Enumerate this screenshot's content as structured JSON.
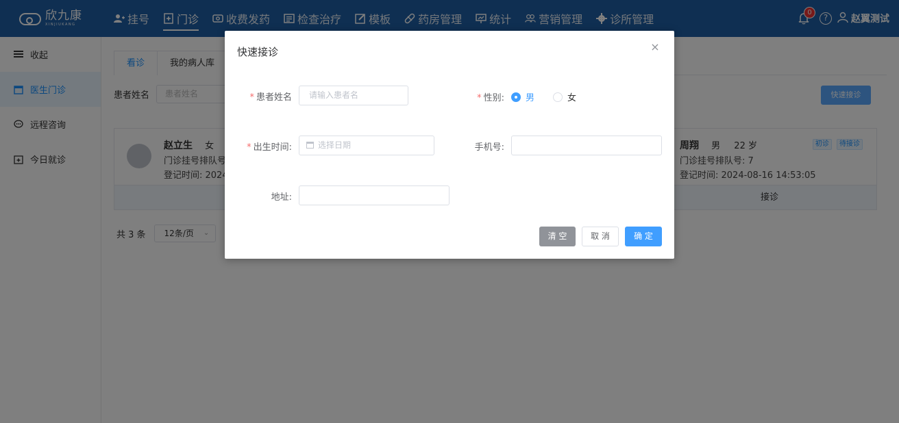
{
  "app": {
    "logo_cn": "欣九康",
    "logo_en": "XINJIUKANG"
  },
  "nav": {
    "items": [
      {
        "label": "挂号",
        "icon": "user-add-icon"
      },
      {
        "label": "门诊",
        "icon": "clinic-doc-icon",
        "active": true
      },
      {
        "label": "收费发药",
        "icon": "cash-icon"
      },
      {
        "label": "检查治疗",
        "icon": "report-icon"
      },
      {
        "label": "模板",
        "icon": "edit-icon"
      },
      {
        "label": "药房管理",
        "icon": "pill-icon"
      },
      {
        "label": "统计",
        "icon": "chart-icon"
      },
      {
        "label": "营销管理",
        "icon": "group-icon"
      },
      {
        "label": "诊所管理",
        "icon": "gear-icon"
      }
    ]
  },
  "header": {
    "notification_count": "0",
    "help_glyph": "?",
    "user_name": "赵翼测试"
  },
  "sidebar": {
    "items": [
      {
        "label": "收起",
        "icon": "menu-icon"
      },
      {
        "label": "医生门诊",
        "icon": "calendar-icon",
        "active": true
      },
      {
        "label": "远程咨询",
        "icon": "chat-icon"
      },
      {
        "label": "今日就诊",
        "icon": "calendar-plus-icon"
      }
    ]
  },
  "main": {
    "tabs": [
      "看诊",
      "我的病人库"
    ],
    "filter_label": "患者姓名",
    "filter_placeholder": "患者姓名",
    "quick_button": "快速接诊",
    "cards": [
      {
        "name": "赵立生",
        "gender": "女",
        "queue": "门诊挂号排队号",
        "time": "登记时间: 2024-"
      },
      {
        "name": "周翔",
        "gender": "男",
        "age": "22 岁",
        "tags": [
          "初诊",
          "待接诊"
        ],
        "queue": "门诊挂号排队号:  7",
        "time": "登记时间: 2024-08-16 14:53:05",
        "action": "接诊"
      }
    ],
    "pager": {
      "total": "共 3 条",
      "page_size": "12条/页"
    }
  },
  "dialog": {
    "title": "快速接诊",
    "close_glyph": "×",
    "name_label": "患者姓名",
    "name_placeholder": "请输入患者名",
    "gender_label": "性别:",
    "gender_options": [
      "男",
      "女"
    ],
    "gender_selected": "男",
    "birth_label": "出生时间:",
    "birth_placeholder": "选择日期",
    "phone_label": "手机号:",
    "phone_value": "",
    "address_label": "地址:",
    "address_value": "",
    "required_mark": "*",
    "buttons": {
      "clear": "清 空",
      "cancel": "取 消",
      "ok": "确 定"
    }
  }
}
